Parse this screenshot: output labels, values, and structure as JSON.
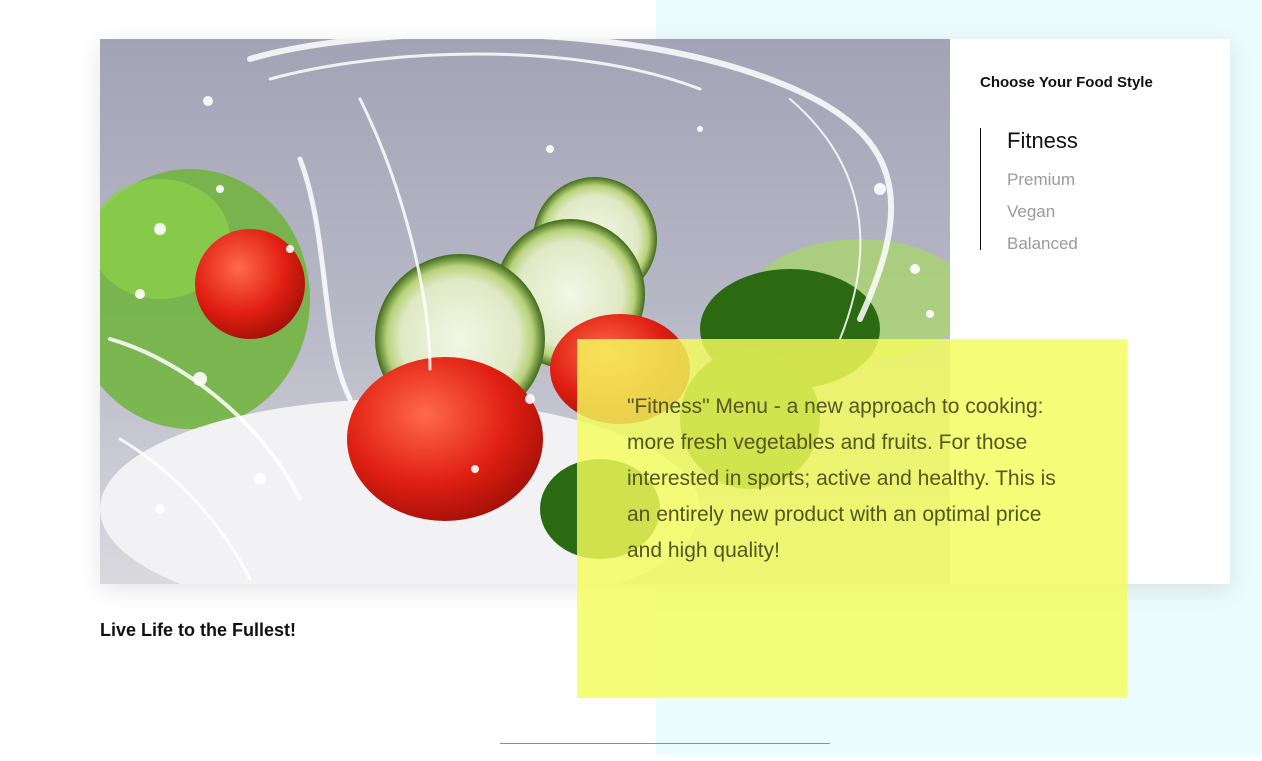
{
  "side": {
    "title": "Choose Your Food Style",
    "styles": [
      "Fitness",
      "Premium",
      "Vegan",
      "Balanced"
    ],
    "active_index": 0
  },
  "description": "\"Fitness\" Menu - a new approach to cooking: more fresh vegetables and fruits. For those interested in sports; active and healthy. This is an entirely new product with an optimal price and high quality!",
  "tagline": "Live Life to the Fullest!",
  "colors": {
    "accent_yellow": "#f4fc5c",
    "background_panel": "#ecfbfc"
  },
  "image": {
    "subject": "salad-photo"
  }
}
